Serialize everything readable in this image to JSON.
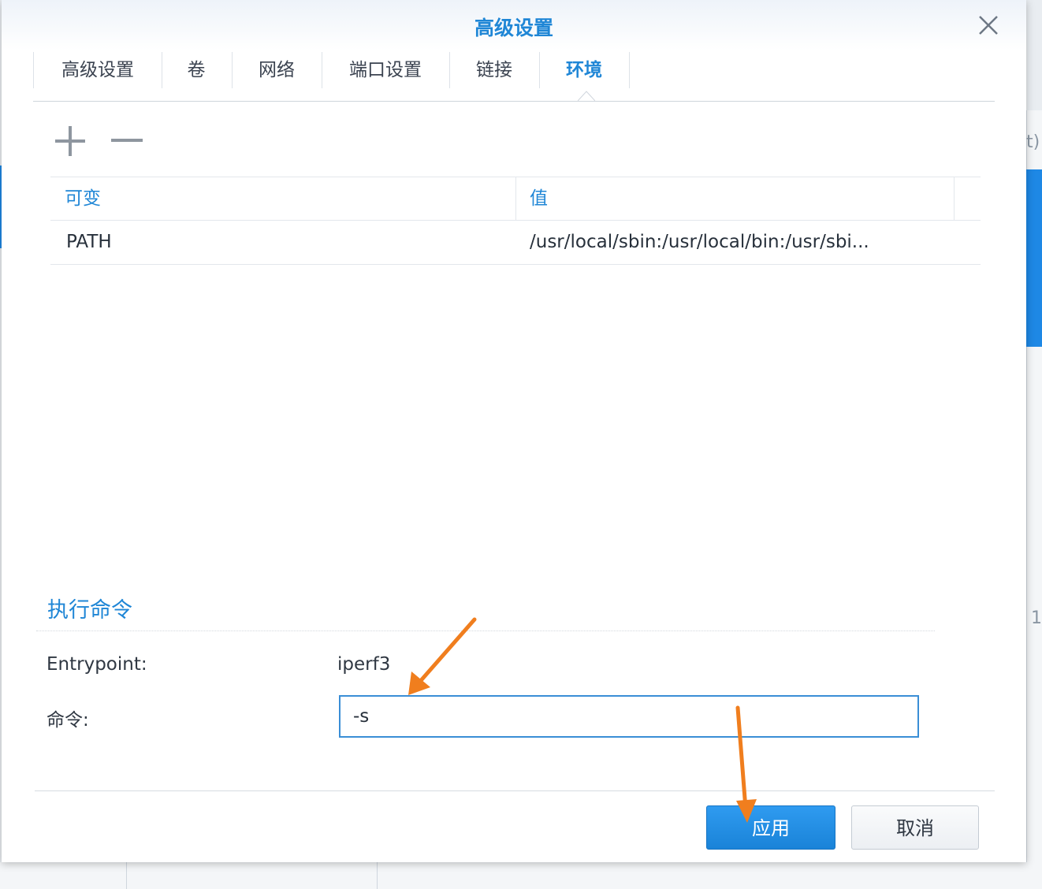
{
  "dialog": {
    "title": "高级设置"
  },
  "tabs": [
    {
      "label": "高级设置",
      "active": false
    },
    {
      "label": "卷",
      "active": false
    },
    {
      "label": "网络",
      "active": false
    },
    {
      "label": "端口设置",
      "active": false
    },
    {
      "label": "链接",
      "active": false
    },
    {
      "label": "环境",
      "active": true
    }
  ],
  "toolbar": {
    "add_icon": "plus-icon",
    "remove_icon": "minus-icon"
  },
  "env_table": {
    "headers": [
      "可变",
      "值"
    ],
    "rows": [
      {
        "variable": "PATH",
        "value": "/usr/local/sbin:/usr/local/bin:/usr/sbi..."
      }
    ]
  },
  "exec": {
    "section_title": "执行命令",
    "entrypoint_label": "Entrypoint:",
    "entrypoint_value": "iperf3",
    "command_label": "命令:",
    "command_value": "-s"
  },
  "buttons": {
    "apply": "应用",
    "cancel": "取消"
  },
  "colors": {
    "accent": "#1f86d6",
    "annotation_arrow": "#f07e1e"
  },
  "background": {
    "right_fragment_a": "t)",
    "right_fragment_b": "1"
  }
}
